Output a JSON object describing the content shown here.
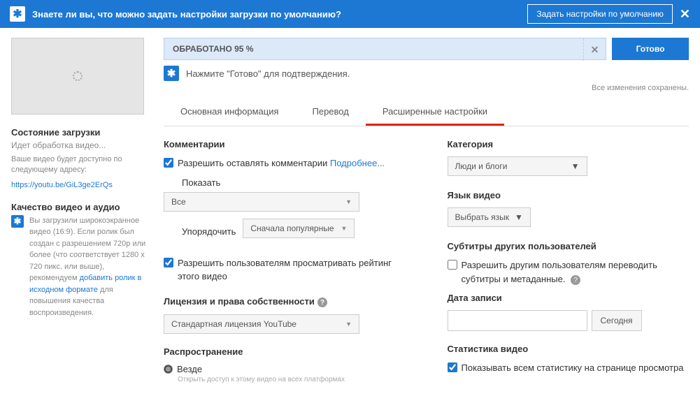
{
  "banner": {
    "message": "Знаете ли вы, что можно задать настройки загрузки по умолчанию?",
    "button": "Задать настройки по умолчанию"
  },
  "side": {
    "status_h": "Состояние загрузки",
    "status_sub": "Идет обработка видео...",
    "status_desc": "Ваше видео будет доступно по следующему адресу:",
    "video_url": "https://youtu.be/GiL3ge2ErQs",
    "quality_h": "Качество видео и аудио",
    "quality_txt1": "Вы загрузили широкоэкранное видео (16:9). Если ролик был создан с разрешением 720p или более (что соответствует 1280 x 720 пикс. или выше), рекомендуем ",
    "quality_link": "добавить ролик в исходном формате",
    "quality_txt2": " для повышения качества воспроизведения."
  },
  "progress": "ОБРАБОТАНО 95 %",
  "done_btn": "Готово",
  "instruction": "Нажмите \"Готово\" для подтверждения.",
  "saved": "Все изменения сохранены.",
  "tabs": {
    "t1": "Основная информация",
    "t2": "Перевод",
    "t3": "Расширенные настройки"
  },
  "left": {
    "comments_h": "Комментарии",
    "allow_comments": "Разрешить оставлять комментарии ",
    "more": "Подробнее...",
    "show_lbl": "Показать",
    "show_val": "Все",
    "sort_lbl": "Упорядочить",
    "sort_val": "Сначала популярные",
    "allow_rating": "Разрешить пользователям просматривать рейтинг этого видео",
    "license_h": "Лицензия и права собственности",
    "license_val": "Стандартная лицензия YouTube",
    "dist_h": "Распространение",
    "dist_opt": "Везде",
    "dist_sub": "Открыть доступ к этому видео на всех платформах"
  },
  "right": {
    "category_h": "Категория",
    "category_val": "Люди и блоги",
    "lang_h": "Язык видео",
    "lang_val": "Выбрать язык",
    "subs_h": "Субтитры других пользователей",
    "subs_chk": "Разрешить другим пользователям переводить субтитры и метаданные.",
    "date_h": "Дата записи",
    "today": "Сегодня",
    "stats_h": "Статистика видео",
    "stats_chk": "Показывать всем статистику на странице просмотра"
  }
}
